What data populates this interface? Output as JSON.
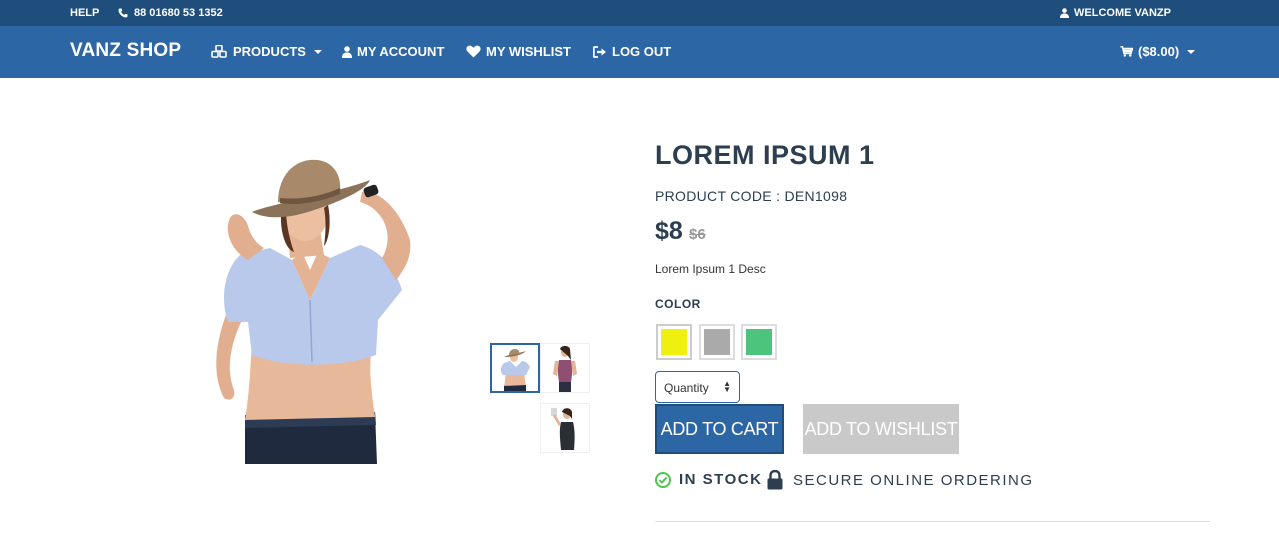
{
  "topbar": {
    "help": "HELP",
    "phone": "88 01680 53 1352",
    "welcome": "WELCOME VANZP"
  },
  "nav": {
    "brand": "VANZ SHOP",
    "products": "PRODUCTS",
    "account": "MY ACCOUNT",
    "wishlist": "MY WISHLIST",
    "logout": "LOG OUT",
    "cart": "($8.00)"
  },
  "product": {
    "title": "LOREM IPSUM 1",
    "code_label": "PRODUCT CODE : DEN1098",
    "price": "$8",
    "old_price": "$6",
    "description": "Lorem Ipsum 1 Desc",
    "color_label": "COLOR",
    "colors": [
      "#f0f00e",
      "#aaaaaa",
      "#4dc47d"
    ],
    "quantity_placeholder": "Quantity",
    "add_to_cart": "ADD TO CART",
    "add_to_wishlist": "ADD TO WISHLIST",
    "stock": "IN STOCK",
    "secure": "SECURE ONLINE ORDERING"
  },
  "colors": {
    "topbar": "#1f4d7c",
    "navbar": "#2d66a5",
    "accent": "#2d66a5",
    "in_stock": "#4dc44d"
  }
}
